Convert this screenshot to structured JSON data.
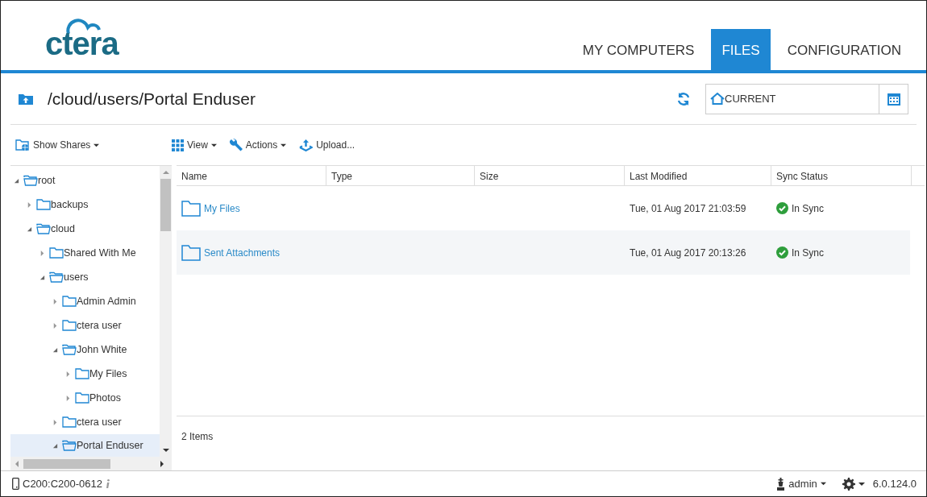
{
  "logo": {
    "text": "ctera"
  },
  "tabs": [
    {
      "label": "MY COMPUTERS",
      "selected": false
    },
    {
      "label": "FILES",
      "selected": true
    },
    {
      "label": "CONFIGURATION",
      "selected": false
    }
  ],
  "path": {
    "title": "/cloud/users/Portal Enduser"
  },
  "version_field": {
    "value": "CURRENT"
  },
  "sidebar": {
    "show_shares": "Show Shares"
  },
  "toolbar": [
    {
      "kind": "grid",
      "label": "View",
      "dropdown": true
    },
    {
      "kind": "wrench",
      "label": "Actions",
      "dropdown": true
    },
    {
      "kind": "upload",
      "label": "Upload...",
      "dropdown": false
    }
  ],
  "tree": [
    {
      "label": "root",
      "expanded": true,
      "selected": false,
      "children": [
        {
          "label": "backups",
          "expanded": false,
          "selected": false
        },
        {
          "label": "cloud",
          "expanded": true,
          "selected": false,
          "children": [
            {
              "label": "Shared With Me",
              "expanded": false,
              "selected": false
            },
            {
              "label": "users",
              "expanded": true,
              "selected": false,
              "children": [
                {
                  "label": "Admin Admin",
                  "expanded": false,
                  "selected": false
                },
                {
                  "label": "ctera user",
                  "expanded": false,
                  "selected": false
                },
                {
                  "label": "John White",
                  "expanded": true,
                  "selected": false,
                  "children": [
                    {
                      "label": "My Files",
                      "expanded": false,
                      "selected": false
                    },
                    {
                      "label": "Photos",
                      "expanded": false,
                      "selected": false
                    }
                  ]
                },
                {
                  "label": "ctera user",
                  "expanded": false,
                  "selected": false
                },
                {
                  "label": "Portal Enduser",
                  "expanded": true,
                  "selected": true
                }
              ]
            }
          ]
        }
      ]
    }
  ],
  "table": {
    "columns": [
      "Name",
      "Type",
      "Size",
      "Last Modified",
      "Sync Status"
    ],
    "rows": [
      {
        "name": "My Files",
        "type": "",
        "size": "",
        "modified": "Tue, 01 Aug 2017 21:03:59",
        "sync": "In Sync"
      },
      {
        "name": "Sent Attachments",
        "type": "",
        "size": "",
        "modified": "Tue, 01 Aug 2017 20:13:26",
        "sync": "In Sync"
      }
    ],
    "count": "2 Items"
  },
  "status_bar": {
    "device": "C200:C200-0612",
    "user": "admin",
    "version": "6.0.124.0"
  }
}
